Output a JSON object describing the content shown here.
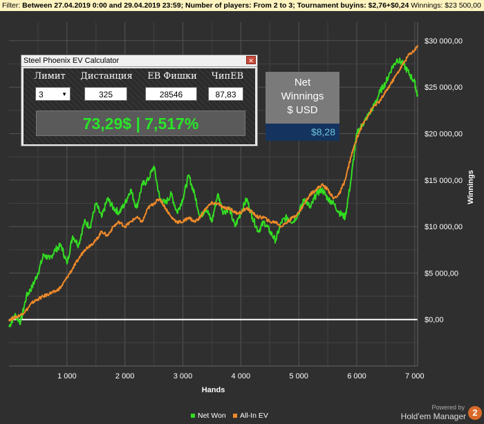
{
  "filter": {
    "label": "Filter:",
    "text": "Between 27.04.2019 0:00 and 29.04.2019 23:59; Number of players: From 2 to 3; Tournament buyins: $2,76+$0,24",
    "winnings": "Winnings: $23 500,00"
  },
  "calculator": {
    "title": "Steel Phoenix EV Calculator",
    "close": "✕",
    "labels": {
      "limit": "Лимит",
      "distance": "Дистанция",
      "ev_chips": "ЕВ Фишки",
      "chip_ev": "ЧипЕВ"
    },
    "values": {
      "limit": "3",
      "distance": "325",
      "ev_chips": "28546",
      "chip_ev": "87,83"
    },
    "result": "73,29$ | 7,517%"
  },
  "net_winnings": {
    "line1": "Net",
    "line2": "Winnings",
    "line3": "$ USD",
    "value": "$8,28"
  },
  "legend": {
    "net_won": "Net Won",
    "allin_ev": "All-In EV"
  },
  "branding": {
    "powered": "Powered by",
    "name": "Hold'em Manager",
    "badge": "2"
  },
  "colors": {
    "net_won": "#33dd22",
    "allin_ev": "#ef8a2a",
    "zero_line": "#ffffff"
  },
  "chart_data": {
    "type": "line",
    "xlabel": "Hands",
    "ylabel": "Winnings",
    "xlim": [
      0,
      7050
    ],
    "ylim": [
      -5000,
      32000
    ],
    "x_ticks": [
      1000,
      2000,
      3000,
      4000,
      5000,
      6000,
      7000
    ],
    "x_tick_labels": [
      "1 000",
      "2 000",
      "3 000",
      "4 000",
      "5 000",
      "6 000",
      "7 000"
    ],
    "y_ticks": [
      0,
      5000,
      10000,
      15000,
      20000,
      25000,
      30000
    ],
    "y_tick_labels": [
      "$0,00",
      "$5 000,00",
      "$10 000,00",
      "$15 000,00",
      "$20 000,00",
      "$25 000,00",
      "$30 000,00"
    ],
    "grid": true,
    "legend_position": "bottom",
    "series": [
      {
        "name": "Net Won",
        "x": [
          0,
          100,
          200,
          300,
          400,
          500,
          600,
          700,
          800,
          900,
          1000,
          1100,
          1200,
          1300,
          1400,
          1500,
          1600,
          1700,
          1800,
          1900,
          2000,
          2100,
          2200,
          2300,
          2400,
          2500,
          2600,
          2700,
          2800,
          2900,
          3000,
          3100,
          3200,
          3300,
          3400,
          3500,
          3600,
          3700,
          3800,
          3900,
          4000,
          4100,
          4200,
          4300,
          4400,
          4500,
          4600,
          4700,
          4800,
          4900,
          5000,
          5100,
          5200,
          5300,
          5400,
          5500,
          5600,
          5700,
          5800,
          5900,
          6000,
          6100,
          6200,
          6300,
          6400,
          6500,
          6600,
          6700,
          6800,
          6900,
          7000,
          7050
        ],
        "y": [
          -800,
          500,
          -300,
          2500,
          3500,
          5000,
          7000,
          6500,
          7500,
          8000,
          6000,
          9000,
          8000,
          10500,
          10000,
          12500,
          11000,
          13000,
          12000,
          11500,
          12500,
          14000,
          12000,
          14500,
          15000,
          16500,
          13000,
          12500,
          13500,
          11500,
          13000,
          15500,
          13500,
          11000,
          12000,
          10500,
          13500,
          11500,
          12000,
          10000,
          11500,
          13000,
          11000,
          9500,
          10500,
          9500,
          8500,
          10500,
          11000,
          10500,
          11500,
          13000,
          12000,
          13500,
          14000,
          13000,
          12500,
          11500,
          11000,
          15000,
          20000,
          21000,
          22000,
          23000,
          24500,
          25500,
          27000,
          28000,
          27500,
          26500,
          25500,
          24000
        ]
      },
      {
        "name": "All-In EV",
        "x": [
          0,
          100,
          200,
          300,
          400,
          500,
          600,
          700,
          800,
          900,
          1000,
          1100,
          1200,
          1300,
          1400,
          1500,
          1600,
          1700,
          1800,
          1900,
          2000,
          2100,
          2200,
          2300,
          2400,
          2500,
          2600,
          2700,
          2800,
          2900,
          3000,
          3100,
          3200,
          3300,
          3400,
          3500,
          3600,
          3700,
          3800,
          3900,
          4000,
          4100,
          4200,
          4300,
          4400,
          4500,
          4600,
          4700,
          4800,
          4900,
          5000,
          5100,
          5200,
          5300,
          5400,
          5500,
          5600,
          5700,
          5800,
          5900,
          6000,
          6100,
          6200,
          6300,
          6400,
          6500,
          6600,
          6700,
          6800,
          6900,
          7000,
          7050
        ],
        "y": [
          0,
          200,
          500,
          1000,
          1800,
          2200,
          2500,
          2800,
          3000,
          3500,
          4500,
          5500,
          6500,
          7500,
          8000,
          8500,
          9500,
          9000,
          10000,
          10500,
          10000,
          10500,
          11000,
          10500,
          12000,
          12500,
          13000,
          12000,
          11000,
          10500,
          10500,
          11000,
          10500,
          11000,
          12000,
          12500,
          12500,
          12000,
          12000,
          11500,
          11500,
          12000,
          11500,
          11000,
          11000,
          10500,
          10500,
          10000,
          10500,
          11000,
          11500,
          12500,
          13500,
          14000,
          14500,
          14000,
          13000,
          13500,
          15000,
          17500,
          19500,
          21000,
          22000,
          23000,
          23500,
          24500,
          25500,
          26500,
          27500,
          28500,
          29000,
          29500
        ]
      }
    ]
  }
}
